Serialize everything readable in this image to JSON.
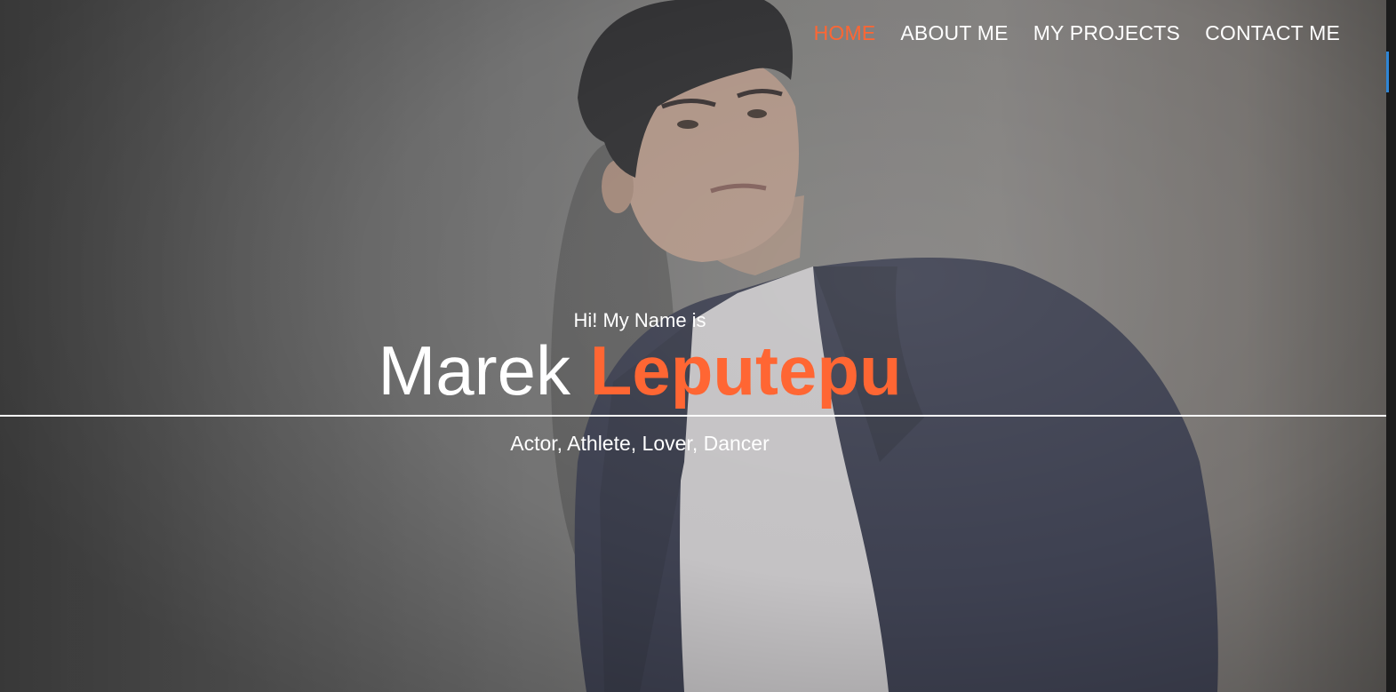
{
  "nav": {
    "items": [
      {
        "label": "HOME",
        "active": true
      },
      {
        "label": "ABOUT ME",
        "active": false
      },
      {
        "label": "MY PROJECTS",
        "active": false
      },
      {
        "label": "CONTACT ME",
        "active": false
      }
    ]
  },
  "hero": {
    "intro": "Hi! My Name is",
    "first_name": "Marek",
    "last_name": "Leputepu",
    "tagline": "Actor, Athlete, Lover, Dancer"
  },
  "colors": {
    "accent": "#ff6633",
    "text": "#ffffff",
    "scroll_thumb": "#2f86d6"
  }
}
